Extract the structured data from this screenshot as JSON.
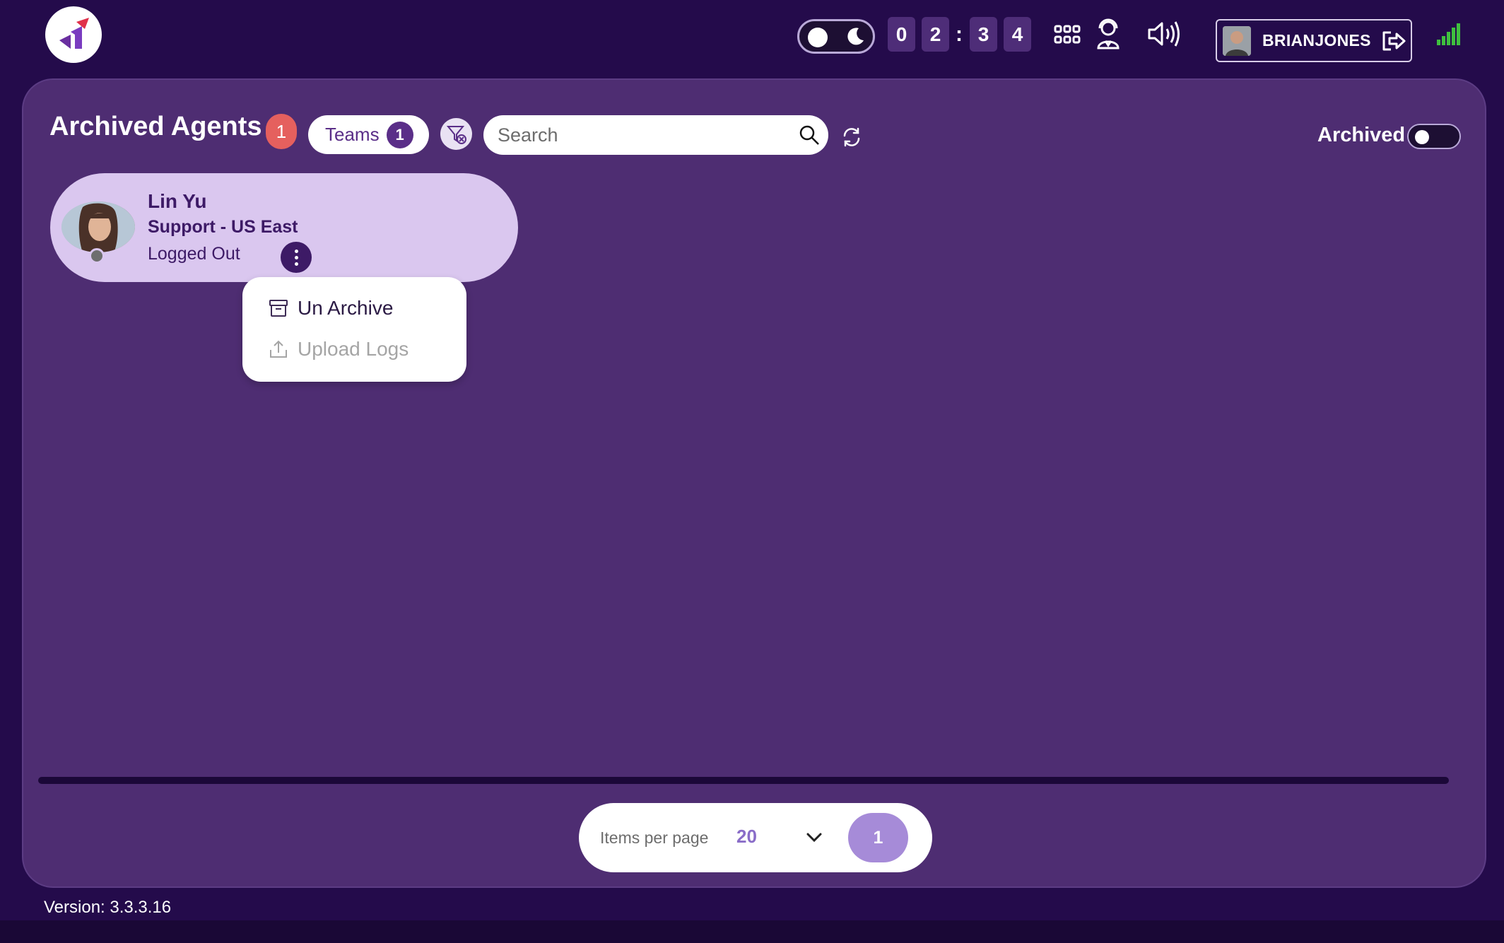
{
  "header": {
    "timer": {
      "d1": "0",
      "d2": "2",
      "sep": ":",
      "d3": "3",
      "d4": "4"
    },
    "user": {
      "name": "BRIANJONES"
    },
    "icons": [
      "app-logo-icon",
      "sun-icon",
      "moon-icon",
      "apps-grid-icon",
      "agent-headset-icon",
      "speaker-icon",
      "logout-icon",
      "signal-bars-icon"
    ]
  },
  "main": {
    "title": "Archived Agents",
    "title_count": "1",
    "teams_label": "Teams",
    "teams_count": "1",
    "search": {
      "placeholder": "Search",
      "value": ""
    },
    "archived_label": "Archived",
    "archived_toggle_on": false
  },
  "agent": {
    "name": "Lin Yu",
    "team": "Support - US East",
    "status": "Logged Out"
  },
  "context_menu": {
    "items": [
      {
        "label": "Un Archive",
        "enabled": true,
        "icon": "archive-box-icon"
      },
      {
        "label": "Upload Logs",
        "enabled": false,
        "icon": "upload-icon"
      }
    ]
  },
  "pagination": {
    "items_per_page_label": "Items per page",
    "items_per_page_value": "20",
    "current_page": "1"
  },
  "footer": {
    "version": "Version: 3.3.3.16"
  },
  "colors": {
    "background": "#240b4b",
    "panel": "#4e2d72",
    "card": "#dac7ef",
    "badge": "#e5605e",
    "accent": "#5a2e88",
    "page_active": "#a68bd8",
    "signal": "#3fbf3f"
  }
}
